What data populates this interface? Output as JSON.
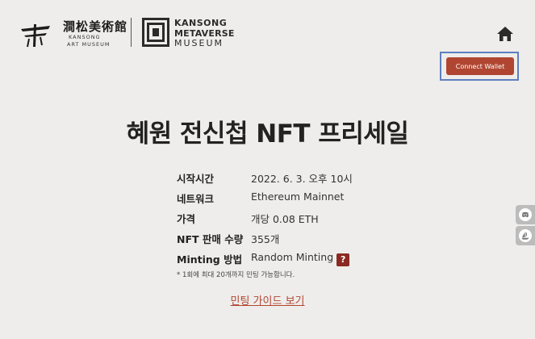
{
  "brand": {
    "hanja": "澗松美術館",
    "en_line1": "KANSONG",
    "en_line2": "ART MUSEUM",
    "metaverse_line1": "KANSONG",
    "metaverse_line2": "METAVERSE",
    "metaverse_line3": "MUSEUM"
  },
  "header": {
    "home_icon": "home-icon",
    "connect_wallet_label": "Connect Wallet"
  },
  "main": {
    "title": "혜원 전신첩 NFT 프리세일",
    "info": [
      {
        "key": "시작시간",
        "value": "2022. 6. 3. 오후 10시"
      },
      {
        "key": "네트워크",
        "value": "Ethereum Mainnet"
      },
      {
        "key": "가격",
        "value": "개당 0.08 ETH"
      },
      {
        "key": "NFT 판매 수량",
        "value": "355개"
      },
      {
        "key": "Minting 방법",
        "value": "Random Minting"
      }
    ],
    "help_badge": "?",
    "note": "* 1회에 최대 20개까지 민팅 가능합니다.",
    "guide_link": "민팅 가이드 보기"
  },
  "side": {
    "buttons": [
      "discord-icon",
      "opensea-icon"
    ]
  },
  "colors": {
    "background": "#efedeb",
    "accent": "#b04631",
    "highlight_frame": "#5d7fbf"
  }
}
